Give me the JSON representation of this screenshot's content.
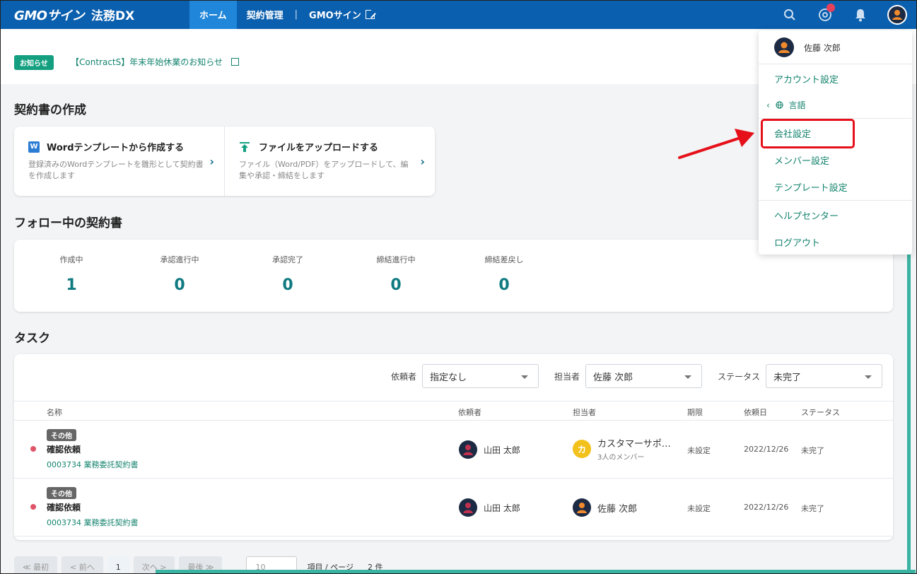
{
  "header": {
    "brand": "GMOサイン",
    "product": "法務DX",
    "tabs": [
      {
        "label": "ホーム"
      },
      {
        "label": "契約管理"
      },
      {
        "label": "GMOサイン"
      }
    ],
    "separator": "|"
  },
  "notice": {
    "badge": "お知らせ",
    "text": "【ContractS】年末年始休業のお知らせ"
  },
  "create": {
    "title": "契約書の作成",
    "word": {
      "icon_text": "W",
      "title": "Wordテンプレートから作成する",
      "desc": "登録済みのWordテンプレートを雛形として契約書を作成します"
    },
    "upload": {
      "title": "ファイルをアップロードする",
      "desc": "ファイル（Word/PDF）をアップロードして、編集や承認・締結をします"
    },
    "chevron": "›"
  },
  "follow": {
    "title": "フォロー中の契約書",
    "stats": [
      {
        "label": "作成中",
        "value": "1"
      },
      {
        "label": "承認進行中",
        "value": "0"
      },
      {
        "label": "承認完了",
        "value": "0"
      },
      {
        "label": "締結進行中",
        "value": "0"
      },
      {
        "label": "締結差戻し",
        "value": "0"
      }
    ]
  },
  "tasks": {
    "title": "タスク",
    "filters": {
      "requester_label": "依頼者",
      "requester_value": "指定なし",
      "assignee_label": "担当者",
      "assignee_value": "佐藤 次郎",
      "status_label": "ステータス",
      "status_value": "未完了"
    },
    "columns": [
      "名称",
      "依頼者",
      "担当者",
      "期限",
      "依頼日",
      "ステータス"
    ],
    "rows": [
      {
        "tag": "その他",
        "name": "確認依頼",
        "doc": "0003734 業務委託契約書",
        "requester": "山田 太郎",
        "assignee": "カスタマーサポ…",
        "assignee_sub": "3人のメンバー",
        "assignee_initial": "カ",
        "due": "未設定",
        "date": "2022/12/26",
        "status": "未完了"
      },
      {
        "tag": "その他",
        "name": "確認依頼",
        "doc": "0003734 業務委託契約書",
        "requester": "山田 太郎",
        "assignee": "佐藤 次郎",
        "due": "未設定",
        "date": "2022/12/26",
        "status": "未完了"
      }
    ]
  },
  "pager": {
    "first": "≪ 最初",
    "prev": "< 前へ",
    "current": "1",
    "next": "次へ >",
    "last": "最後 ≫",
    "per_page": "10",
    "suffix": "項目 / ページ",
    "total": "2 件"
  },
  "menu": {
    "user": "佐藤 次郎",
    "account": "アカウント設定",
    "language": "言語",
    "language_chevron": "‹",
    "company": "会社設定",
    "member": "メンバー設定",
    "template": "テンプレート設定",
    "help": "ヘルプセンター",
    "logout": "ログアウト"
  },
  "colors": {
    "header": "#0a5fae",
    "active_tab": "#1f86d9",
    "accent": "#13836e",
    "highlight": "#e6101a",
    "unread": "#e8405a"
  }
}
